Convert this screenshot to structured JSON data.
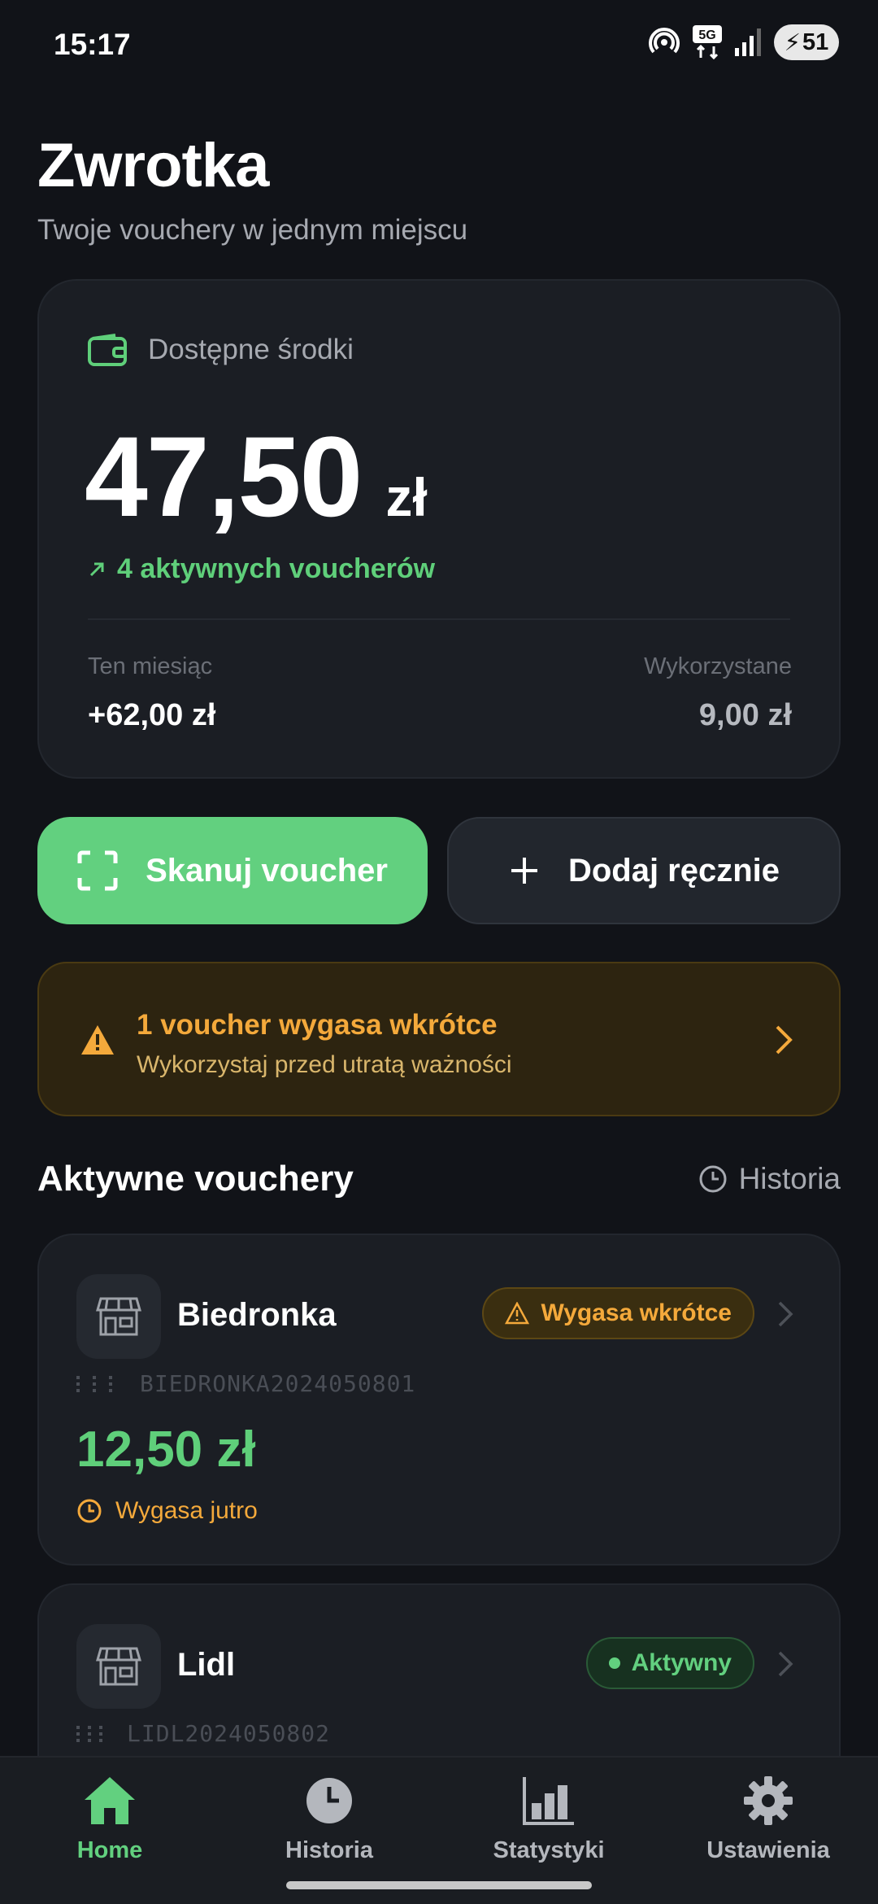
{
  "status_bar": {
    "time": "15:17",
    "battery": "51",
    "network": "5G"
  },
  "header": {
    "title": "Zwrotka",
    "subtitle": "Twoje vouchery w jednym miejscu"
  },
  "balance": {
    "label": "Dostępne środki",
    "amount": "47,50",
    "currency": "zł",
    "active_text": "4 aktywnych voucherów",
    "this_month_label": "Ten miesiąc",
    "this_month_value": "+62,00 zł",
    "used_label": "Wykorzystane",
    "used_value": "9,00 zł"
  },
  "actions": {
    "scan_label": "Skanuj voucher",
    "add_label": "Dodaj ręcznie"
  },
  "warning": {
    "title": "1 voucher wygasa wkrótce",
    "subtitle": "Wykorzystaj przed utratą ważności"
  },
  "section": {
    "title": "Aktywne vouchery",
    "history_link": "Historia"
  },
  "vouchers": [
    {
      "store": "Biedronka",
      "badge": "Wygasa wkrótce",
      "code": "BIEDRONKA2024050801",
      "amount": "12,50 zł",
      "expiry": "Wygasa jutro"
    },
    {
      "store": "Lidl",
      "badge": "Aktywny",
      "code": "LIDL2024050802"
    }
  ],
  "nav": {
    "home": "Home",
    "history": "Historia",
    "stats": "Statystyki",
    "settings": "Ustawienia"
  },
  "colors": {
    "accent": "#62d07f",
    "warning": "#f4a93b",
    "background": "#111318",
    "card": "#1b1e24"
  }
}
